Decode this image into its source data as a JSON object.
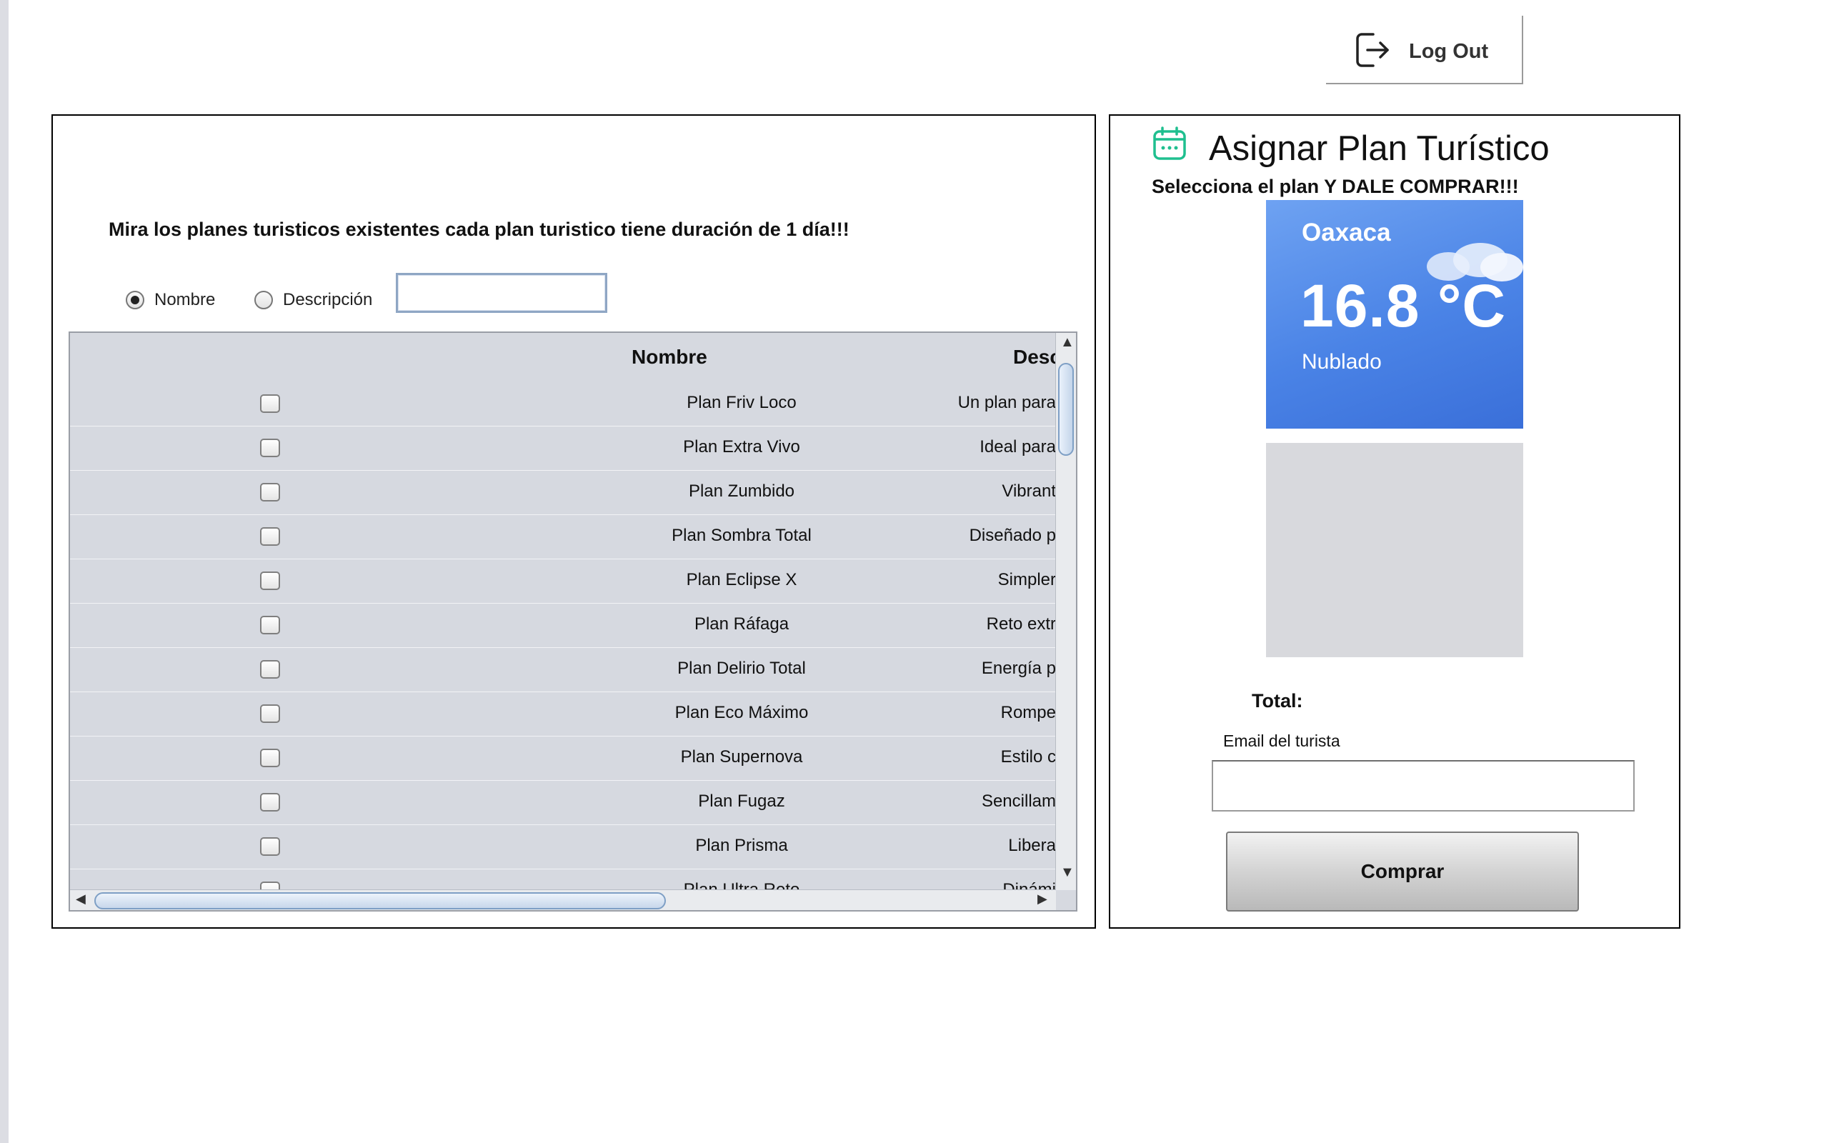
{
  "header": {
    "logout_label": "Log Out"
  },
  "left": {
    "headline": "Mira los planes turisticos existentes cada plan turistico tiene duración de 1 día!!!",
    "filters": {
      "nombre_label": "Nombre",
      "descripcion_label": "Descripción",
      "selected": "Nombre",
      "search_value": ""
    },
    "table": {
      "columns": [
        "",
        "Nombre",
        "Desc"
      ],
      "rows": [
        {
          "nombre": "Plan Friv Loco",
          "descripcion": "Un plan para"
        },
        {
          "nombre": "Plan Extra Vivo",
          "descripcion": "Ideal para"
        },
        {
          "nombre": "Plan Zumbido",
          "descripcion": "Vibrant"
        },
        {
          "nombre": "Plan Sombra Total",
          "descripcion": "Diseñado p"
        },
        {
          "nombre": "Plan Eclipse X",
          "descripcion": "Simpler"
        },
        {
          "nombre": "Plan Ráfaga",
          "descripcion": "Reto extr"
        },
        {
          "nombre": "Plan Delirio Total",
          "descripcion": "Energía p"
        },
        {
          "nombre": "Plan Eco Máximo",
          "descripcion": "Rompe"
        },
        {
          "nombre": "Plan Supernova",
          "descripcion": "Estilo c"
        },
        {
          "nombre": "Plan Fugaz",
          "descripcion": "Sencillam"
        },
        {
          "nombre": "Plan Prisma",
          "descripcion": "Libera"
        },
        {
          "nombre": "Plan Ultra Reto",
          "descripcion": "Dinámi"
        }
      ]
    }
  },
  "right": {
    "title": "Asignar Plan Turístico",
    "subtitle": "Selecciona el plan Y DALE COMPRAR!!!",
    "weather": {
      "city": "Oaxaca",
      "temperature": "16.8 °C",
      "condition": "Nublado"
    },
    "total_label": "Total:",
    "email_label": "Email del turista",
    "email_value": "",
    "buy_label": "Comprar"
  },
  "colors": {
    "weather_gradient_start": "#6ea2f2",
    "weather_gradient_end": "#3a6fd9",
    "calendar_icon": "#1fbf8f",
    "table_bg": "#d6d9e0"
  }
}
